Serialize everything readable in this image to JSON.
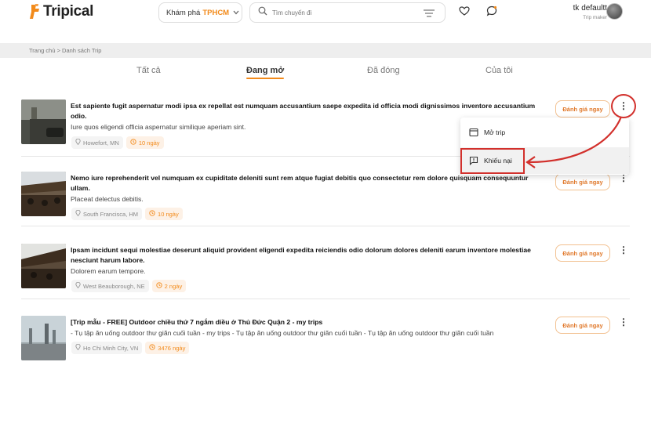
{
  "header": {
    "logo": "Tripical",
    "explore_label": "Khám phá",
    "explore_city": "TPHCM",
    "search_placeholder": "Tìm chuyến đi",
    "user_name": "tk defaultt",
    "user_role": "Trip maker"
  },
  "breadcrumb": "Trang chủ > Danh sách Trip",
  "tabs": [
    {
      "label": "Tất cả"
    },
    {
      "label": "Đang mở"
    },
    {
      "label": "Đã đóng"
    },
    {
      "label": "Của tôi"
    }
  ],
  "active_tab": "Đang mở",
  "rate_label": "Đánh giá ngay",
  "trips": [
    {
      "title": "Est sapiente fugit aspernatur modi ipsa ex repellat est numquam accusantium saepe expedita id officia modi dignissimos inventore accusantium odio.",
      "description": "Iure quos eligendi officia aspernatur similique aperiam sint.",
      "location": "Howefort, MN",
      "duration": "10 ngày"
    },
    {
      "title": "Nemo iure reprehenderit vel numquam ex cupiditate deleniti sunt rem atque fugiat debitis quo consectetur rem dolore quisquam consequuntur ullam.",
      "description": "Placeat delectus debitis.",
      "location": "South Francisca, HM",
      "duration": "10 ngày"
    },
    {
      "title": "Ipsam incidunt sequi molestiae deserunt aliquid provident eligendi expedita reiciendis odio dolorum dolores deleniti earum inventore molestiae nesciunt harum labore.",
      "description": "Dolorem earum tempore.",
      "location": "West Beauborough, NE",
      "duration": "2 ngày"
    },
    {
      "title": "[Trip mẫu - FREE] Outdoor chiều thứ 7 ngắm diều ở Thủ Đức Quận 2 - my trips",
      "description": "- Tụ tập ăn uống outdoor thư giãn cuối tuần - my trips - Tụ tập ăn uống outdoor thư giãn cuối tuần - Tụ tập ăn uống outdoor thư giãn cuối tuần",
      "location": "Ho Chi Minh City, VN",
      "duration": "3476 ngày"
    }
  ],
  "menu": {
    "open_trip": "Mở trip",
    "complaint": "Khiếu nại"
  },
  "colors": {
    "accent": "#f28a1a",
    "annotation": "#d2302c"
  },
  "icons": {
    "logo": "tripical-logo-icon",
    "explore": "chevron-down-icon",
    "search": "search-icon",
    "filter": "filter-icon",
    "favorite": "heart-icon",
    "chat": "chat-icon",
    "location": "location-pin-icon",
    "clock": "clock-icon",
    "more": "kebab-menu-icon",
    "open_trip": "window-icon",
    "complaint": "report-icon"
  }
}
